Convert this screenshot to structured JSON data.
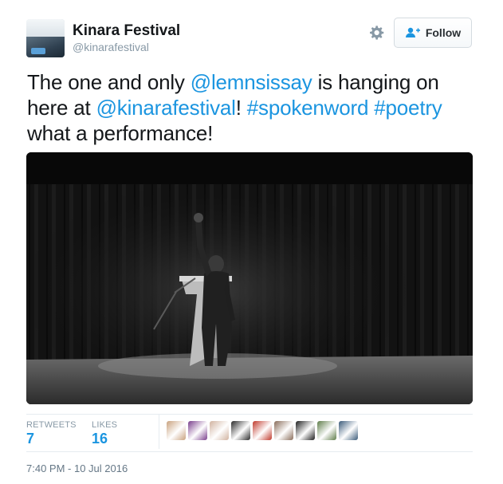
{
  "author": {
    "name": "Kinara Festival",
    "handle": "@kinarafestival"
  },
  "follow_button": {
    "label": "Follow"
  },
  "tweet": {
    "segments": [
      {
        "text": "The one and only ",
        "link": false
      },
      {
        "text": "@lemnsissay",
        "link": true
      },
      {
        "text": " is hanging on here at ",
        "link": false
      },
      {
        "text": "@kinarafestival",
        "link": true
      },
      {
        "text": "! ",
        "link": false
      },
      {
        "text": "#spokenword",
        "link": true
      },
      {
        "text": " ",
        "link": false
      },
      {
        "text": "#poetry",
        "link": true
      },
      {
        "text": " what a performance!",
        "link": false
      }
    ]
  },
  "photo": {
    "icon": "photo-performer-on-stage"
  },
  "stats": {
    "retweets_label": "RETWEETS",
    "retweets_value": "7",
    "likes_label": "LIKES",
    "likes_value": "16"
  },
  "likers": [
    {
      "icon": "liker-avatar",
      "color": "#c9a27e"
    },
    {
      "icon": "liker-avatar",
      "color": "#7a3f8c"
    },
    {
      "icon": "liker-avatar",
      "color": "#d1b3a0"
    },
    {
      "icon": "liker-avatar-poetry-logo",
      "color": "#2b2b2b"
    },
    {
      "icon": "liker-avatar",
      "color": "#c0392b"
    },
    {
      "icon": "liker-avatar",
      "color": "#8a6d5a"
    },
    {
      "icon": "liker-avatar",
      "color": "#1e1e1e"
    },
    {
      "icon": "liker-avatar",
      "color": "#5f7d4a"
    },
    {
      "icon": "liker-avatar",
      "color": "#3b5b7a"
    }
  ],
  "timestamp": "7:40 PM - 10 Jul 2016",
  "colors": {
    "link": "#1b95e0",
    "muted": "#8899a6"
  }
}
